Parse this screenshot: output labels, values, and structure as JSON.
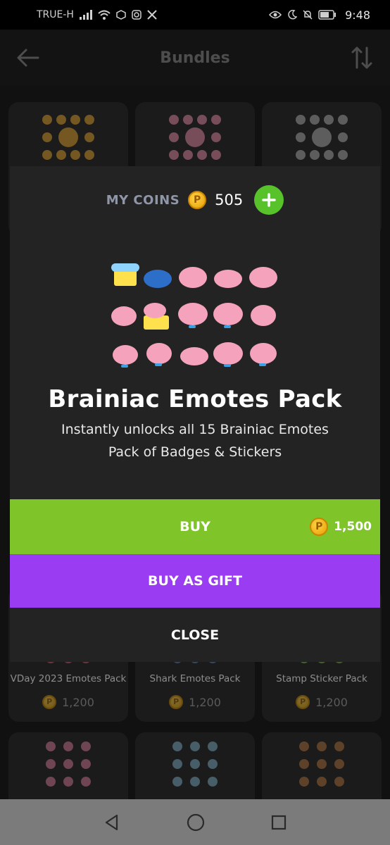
{
  "status_bar": {
    "carrier": "TRUE-H",
    "time": "9:48"
  },
  "app_bar": {
    "title": "Bundles",
    "back_icon": "arrow-left-icon",
    "sort_icon": "sort-arrows-icon"
  },
  "bundles": [
    {
      "name": "",
      "thumb_color": "#e0a02a"
    },
    {
      "name": "",
      "thumb_color": "#e88aa8"
    },
    {
      "name": "",
      "thumb_color": "#d9d9d9"
    },
    {
      "name": "VDay 2023 Emotes Pack",
      "price": "1,200",
      "thumb_color": "#c85a6e"
    },
    {
      "name": "Shark Emotes Pack",
      "price": "1,200",
      "thumb_color": "#5a7fb0"
    },
    {
      "name": "Stamp Sticker Pack",
      "price": "1,200",
      "thumb_color": "#7bb24a"
    },
    {
      "name": "",
      "thumb_color": "#d77b9c"
    },
    {
      "name": "",
      "thumb_color": "#7fb0c8"
    },
    {
      "name": "",
      "thumb_color": "#b0703a"
    }
  ],
  "modal": {
    "coins_label": "MY COINS",
    "coins_value": "505",
    "pack_title": "Brainiac Emotes Pack",
    "pack_description": "Instantly unlocks all 15 Brainiac Emotes Pack of Badges & Stickers",
    "buy_label": "BUY",
    "buy_price": "1,500",
    "gift_label": "BUY AS GIFT",
    "close_label": "CLOSE",
    "colors": {
      "buy": "#7fc52a",
      "gift": "#9a3cf2",
      "add_coins": "#57c22a"
    }
  },
  "nav_bar": {
    "back_icon": "triangle-back-icon",
    "home_icon": "circle-home-icon",
    "recents_icon": "square-recents-icon"
  }
}
